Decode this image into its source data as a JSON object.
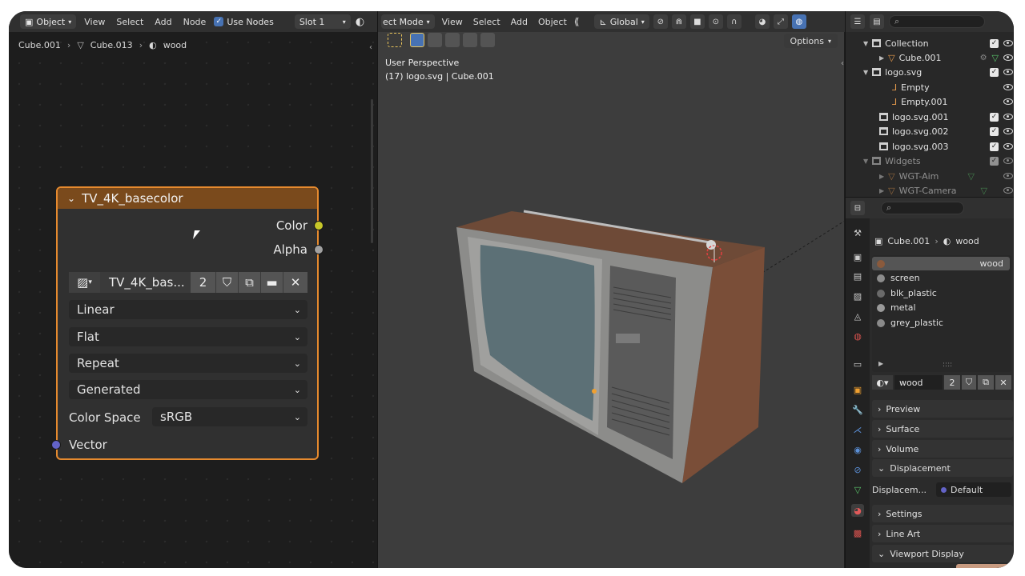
{
  "node_editor": {
    "header": {
      "mode": "Object",
      "menus": [
        "View",
        "Select",
        "Add",
        "Node"
      ],
      "use_nodes": "Use Nodes",
      "slot": "Slot 1"
    },
    "breadcrumb": [
      "Cube.001",
      "Cube.013",
      "wood"
    ],
    "node": {
      "title": "TV_4K_basecolor",
      "outputs": [
        "Color",
        "Alpha"
      ],
      "image_name": "TV_4K_bas...",
      "users": "2",
      "interpolation": "Linear",
      "projection": "Flat",
      "extension": "Repeat",
      "source": "Generated",
      "color_space_label": "Color Space",
      "color_space": "sRGB",
      "input": "Vector",
      "colors": {
        "color_socket": "#c7c729",
        "alpha_socket": "#a1a1a1",
        "vector_socket": "#6363c7",
        "border": "#e68a2e"
      }
    }
  },
  "viewport": {
    "header": {
      "mode": "ect Mode",
      "menus": [
        "View",
        "Select",
        "Add",
        "Object"
      ],
      "orientation": "Global"
    },
    "options": "Options",
    "info_line1": "User Perspective",
    "info_line2": "(17) logo.svg | Cube.001"
  },
  "outliner": {
    "rows": [
      {
        "name": "Collection",
        "icon": "collection-icon",
        "expanded": true
      },
      {
        "name": "Cube.001",
        "icon": "mesh-icon"
      },
      {
        "name": "logo.svg",
        "icon": "collection-icon",
        "expanded": true
      },
      {
        "name": "Empty",
        "icon": "empty-icon"
      },
      {
        "name": "Empty.001",
        "icon": "empty-icon"
      },
      {
        "name": "logo.svg.001",
        "icon": "collection-icon"
      },
      {
        "name": "logo.svg.002",
        "icon": "collection-icon"
      },
      {
        "name": "logo.svg.003",
        "icon": "collection-icon"
      },
      {
        "name": "Widgets",
        "icon": "collection-icon",
        "expanded": true
      },
      {
        "name": "WGT-Aim",
        "icon": "mesh-icon"
      },
      {
        "name": "WGT-Camera",
        "icon": "mesh-icon"
      }
    ]
  },
  "properties": {
    "breadcrumb": [
      "Cube.001",
      "wood"
    ],
    "materials": [
      {
        "name": "wood",
        "color": "#8a5a3c"
      },
      {
        "name": "screen",
        "color": "#8c8c8c"
      },
      {
        "name": "blk_plastic",
        "color": "#6a6a6a"
      },
      {
        "name": "metal",
        "color": "#9a9a9a"
      },
      {
        "name": "grey_plastic",
        "color": "#8a8a8a"
      }
    ],
    "material_name": "wood",
    "material_users": "2",
    "panels": [
      "Preview",
      "Surface",
      "Volume",
      "Displacement",
      "Settings",
      "Line Art",
      "Viewport Display"
    ],
    "displacement_label": "Displacem...",
    "displacement_value": "Default"
  }
}
